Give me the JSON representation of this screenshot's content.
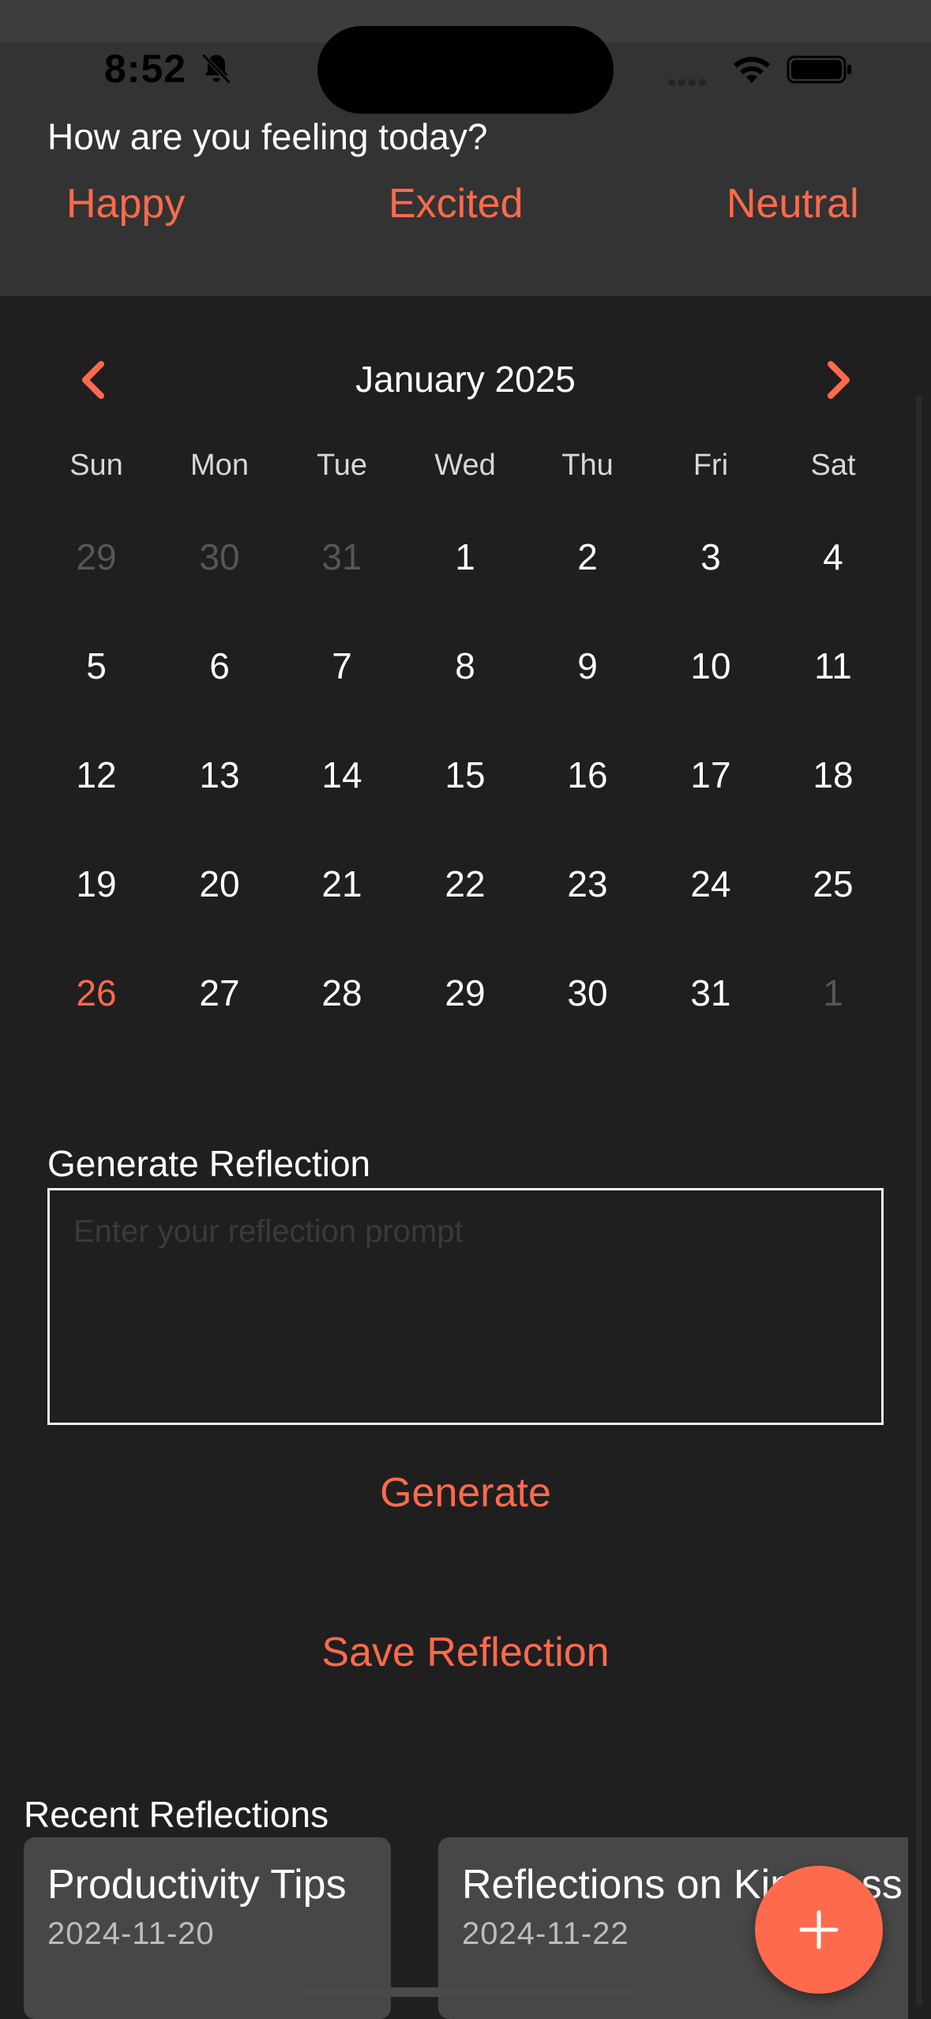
{
  "status": {
    "time": "8:52"
  },
  "mood": {
    "question": "How are you feeling today?",
    "options": [
      "Happy",
      "Excited",
      "Neutral"
    ]
  },
  "calendar": {
    "month_label": "January 2025",
    "weekdays": [
      "Sun",
      "Mon",
      "Tue",
      "Wed",
      "Thu",
      "Fri",
      "Sat"
    ],
    "weeks": [
      [
        "29",
        "30",
        "31",
        "1",
        "2",
        "3",
        "4"
      ],
      [
        "5",
        "6",
        "7",
        "8",
        "9",
        "10",
        "11"
      ],
      [
        "12",
        "13",
        "14",
        "15",
        "16",
        "17",
        "18"
      ],
      [
        "19",
        "20",
        "21",
        "22",
        "23",
        "24",
        "25"
      ],
      [
        "26",
        "27",
        "28",
        "29",
        "30",
        "31",
        "1"
      ]
    ],
    "selected_day": "26"
  },
  "reflection": {
    "label": "Generate Reflection",
    "placeholder": "Enter your reflection prompt",
    "value": "",
    "generate_label": "Generate",
    "save_label": "Save Reflection"
  },
  "recent": {
    "title": "Recent Reflections",
    "items": [
      {
        "title": "Productivity Tips",
        "date": "2024-11-20"
      },
      {
        "title": "Reflections on Kindness",
        "date": "2024-11-22"
      }
    ]
  },
  "colors": {
    "accent": "#ff6a4c",
    "background": "#1f1f1f",
    "header": "#333333",
    "card": "#474747"
  },
  "icons": {
    "prev_month": "chevron-left-icon",
    "next_month": "chevron-right-icon",
    "fab": "plus-icon",
    "mute": "bell-slash-icon"
  }
}
